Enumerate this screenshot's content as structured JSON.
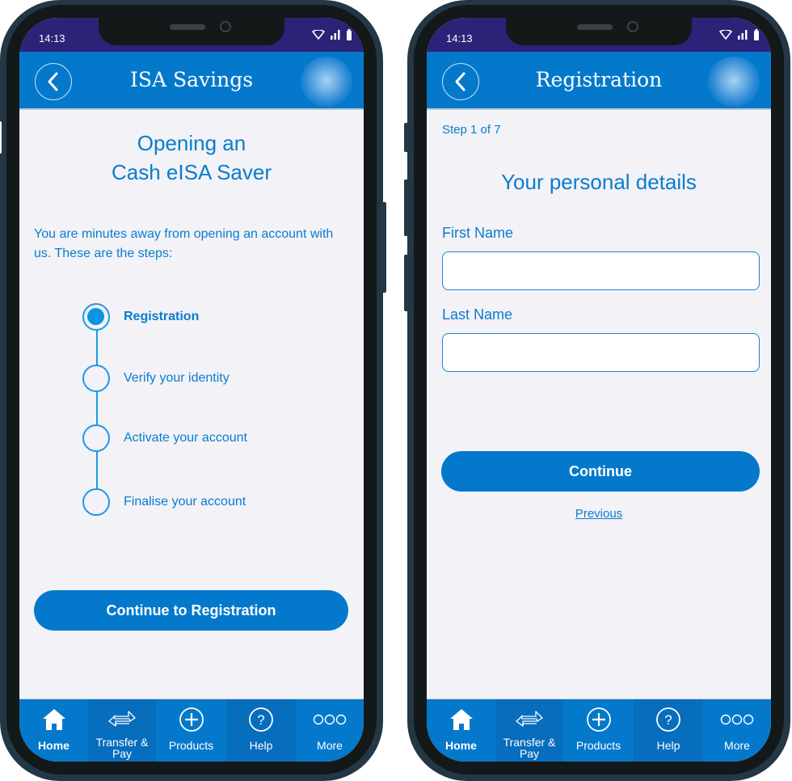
{
  "status_bar": {
    "time": "14:13"
  },
  "colors": {
    "brand_blue": "#0479cc",
    "status_purple": "#2b2377",
    "text_blue": "#0a7ccf",
    "step_blue": "#1a9ae8"
  },
  "tab_bar": {
    "items": [
      {
        "label": "Home",
        "icon": "home-icon",
        "active": true
      },
      {
        "label": "Transfer &",
        "label2": "Pay",
        "icon": "transfer-arrows-icon"
      },
      {
        "label": "Products",
        "icon": "plus-circle-icon"
      },
      {
        "label": "Help",
        "icon": "question-circle-icon"
      },
      {
        "label": "More",
        "icon": "more-dots-icon"
      }
    ]
  },
  "left_screen": {
    "title": "ISA Savings",
    "heading_line1": "Opening an",
    "heading_line2": "Cash eISA Saver",
    "intro": "You are minutes away from opening an account with us. These are the steps:",
    "steps": [
      {
        "label": "Registration",
        "active": true
      },
      {
        "label": "Verify your identity",
        "active": false
      },
      {
        "label": "Activate your account",
        "active": false
      },
      {
        "label": "Finalise your account",
        "active": false
      }
    ],
    "continue_button": "Continue to Registration"
  },
  "right_screen": {
    "title": "Registration",
    "step_counter": "Step 1 of 7",
    "heading": "Your personal details",
    "fields": [
      {
        "label": "First Name",
        "value": "",
        "placeholder": ""
      },
      {
        "label": "Last Name",
        "value": "",
        "placeholder": ""
      }
    ],
    "continue_button": "Continue",
    "previous_link": "Previous"
  }
}
